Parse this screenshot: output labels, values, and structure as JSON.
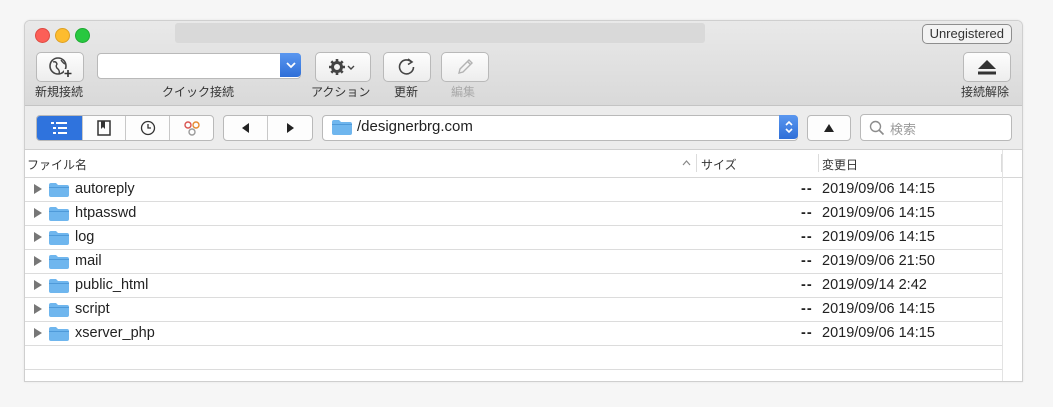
{
  "window": {
    "badge": "Unregistered"
  },
  "toolbar": {
    "new_connection": "新規接続",
    "quick_connect": "クイック接続",
    "quick_connect_value": "",
    "action": "アクション",
    "refresh": "更新",
    "edit": "編集",
    "disconnect": "接続解除"
  },
  "navbar": {
    "path": "/designerbrg.com",
    "search_placeholder": "検索"
  },
  "columns": {
    "name": "ファイル名",
    "size": "サイズ",
    "modified": "変更日"
  },
  "files": [
    {
      "name": "autoreply",
      "size": "--",
      "modified": "2019/09/06 14:15"
    },
    {
      "name": "htpasswd",
      "size": "--",
      "modified": "2019/09/06 14:15"
    },
    {
      "name": "log",
      "size": "--",
      "modified": "2019/09/06 14:15"
    },
    {
      "name": "mail",
      "size": "--",
      "modified": "2019/09/06 21:50"
    },
    {
      "name": "public_html",
      "size": "--",
      "modified": "2019/09/14 2:42"
    },
    {
      "name": "script",
      "size": "--",
      "modified": "2019/09/06 14:15"
    },
    {
      "name": "xserver_php",
      "size": "--",
      "modified": "2019/09/06 14:15"
    }
  ],
  "colors": {
    "accent": "#2f73dd",
    "folder": "#6fb6ee"
  }
}
